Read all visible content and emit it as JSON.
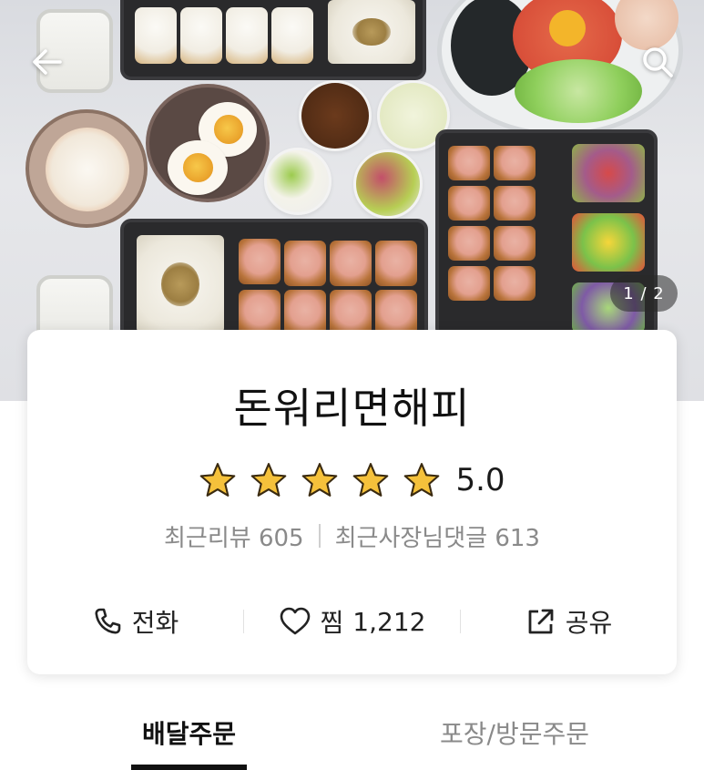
{
  "hero": {
    "image_counter": "1 / 2"
  },
  "store": {
    "name": "돈워리면해피",
    "rating": "5.0",
    "stars_filled": 5,
    "stars_total": 5,
    "recent_reviews_label": "최근리뷰",
    "recent_reviews_count": "605",
    "owner_replies_label": "최근사장님댓글",
    "owner_replies_count": "613"
  },
  "actions": {
    "call_label": "전화",
    "favorite_label": "찜",
    "favorite_count": "1,212",
    "share_label": "공유"
  },
  "tabs": {
    "delivery": "배달주문",
    "pickup": "포장/방문주문",
    "active": "delivery"
  },
  "colors": {
    "star": "#f5c13b",
    "star_outline": "#3a2a10",
    "text_primary": "#111111",
    "text_secondary": "#8a8a8a",
    "counter_bg": "#5a5a5a"
  }
}
